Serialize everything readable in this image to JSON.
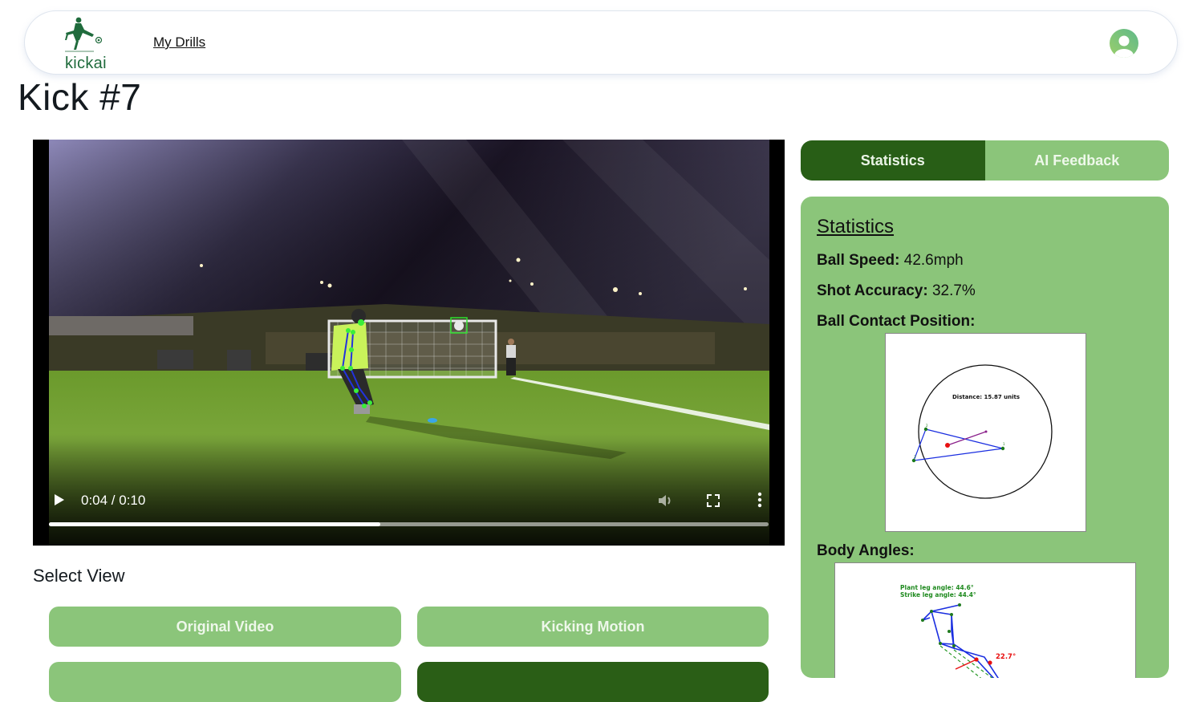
{
  "header": {
    "logo_text": "kickai",
    "nav_link": "My Drills",
    "avatar_icon": "user-avatar-icon"
  },
  "page": {
    "title": "Kick #7"
  },
  "video": {
    "current_time": "0:04",
    "duration": "0:10",
    "time_display": "0:04 / 0:10",
    "progress_fraction": 0.46,
    "controls": [
      "play-icon",
      "volume-icon",
      "fullscreen-icon",
      "more-options-icon"
    ]
  },
  "view_selector": {
    "label": "Select View",
    "buttons": [
      {
        "label": "Original Video",
        "selected": false
      },
      {
        "label": "Kicking Motion",
        "selected": false
      },
      {
        "label": "",
        "selected": false
      },
      {
        "label": "",
        "selected": true
      }
    ]
  },
  "tabs": [
    {
      "label": "Statistics",
      "active": true
    },
    {
      "label": "AI Feedback",
      "active": false
    }
  ],
  "statistics": {
    "heading": "Statistics",
    "ball_speed_label": "Ball Speed:",
    "ball_speed_value": "42.6mph",
    "shot_accuracy_label": "Shot Accuracy:",
    "shot_accuracy_value": "32.7%",
    "contact_label": "Ball Contact Position:",
    "contact_chart": {
      "annotation": "Distance: 15.87 units",
      "point_labels": [
        "1",
        "2",
        "3"
      ]
    },
    "body_angles_label": "Body Angles:",
    "body_angles_chart": {
      "plant_leg": "Plant leg angle: 44.6°",
      "strike_leg": "Strike leg angle: 44.4°",
      "angle_annotation": "22.7°"
    }
  },
  "colors": {
    "primary_dark": "#285e16",
    "primary_light": "#8bc57a",
    "logo_green": "#1f6b3c"
  }
}
